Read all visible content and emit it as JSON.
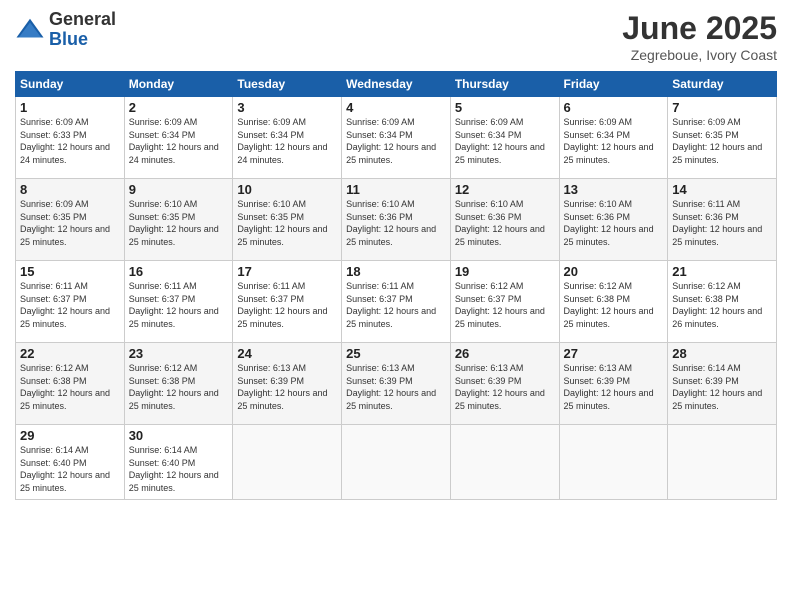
{
  "logo": {
    "general": "General",
    "blue": "Blue"
  },
  "title": "June 2025",
  "subtitle": "Zegreboue, Ivory Coast",
  "weekdays": [
    "Sunday",
    "Monday",
    "Tuesday",
    "Wednesday",
    "Thursday",
    "Friday",
    "Saturday"
  ],
  "weeks": [
    [
      {
        "day": "1",
        "sunrise": "6:09 AM",
        "sunset": "6:33 PM",
        "daylight": "12 hours and 24 minutes."
      },
      {
        "day": "2",
        "sunrise": "6:09 AM",
        "sunset": "6:34 PM",
        "daylight": "12 hours and 24 minutes."
      },
      {
        "day": "3",
        "sunrise": "6:09 AM",
        "sunset": "6:34 PM",
        "daylight": "12 hours and 24 minutes."
      },
      {
        "day": "4",
        "sunrise": "6:09 AM",
        "sunset": "6:34 PM",
        "daylight": "12 hours and 25 minutes."
      },
      {
        "day": "5",
        "sunrise": "6:09 AM",
        "sunset": "6:34 PM",
        "daylight": "12 hours and 25 minutes."
      },
      {
        "day": "6",
        "sunrise": "6:09 AM",
        "sunset": "6:34 PM",
        "daylight": "12 hours and 25 minutes."
      },
      {
        "day": "7",
        "sunrise": "6:09 AM",
        "sunset": "6:35 PM",
        "daylight": "12 hours and 25 minutes."
      }
    ],
    [
      {
        "day": "8",
        "sunrise": "6:09 AM",
        "sunset": "6:35 PM",
        "daylight": "12 hours and 25 minutes."
      },
      {
        "day": "9",
        "sunrise": "6:10 AM",
        "sunset": "6:35 PM",
        "daylight": "12 hours and 25 minutes."
      },
      {
        "day": "10",
        "sunrise": "6:10 AM",
        "sunset": "6:35 PM",
        "daylight": "12 hours and 25 minutes."
      },
      {
        "day": "11",
        "sunrise": "6:10 AM",
        "sunset": "6:36 PM",
        "daylight": "12 hours and 25 minutes."
      },
      {
        "day": "12",
        "sunrise": "6:10 AM",
        "sunset": "6:36 PM",
        "daylight": "12 hours and 25 minutes."
      },
      {
        "day": "13",
        "sunrise": "6:10 AM",
        "sunset": "6:36 PM",
        "daylight": "12 hours and 25 minutes."
      },
      {
        "day": "14",
        "sunrise": "6:11 AM",
        "sunset": "6:36 PM",
        "daylight": "12 hours and 25 minutes."
      }
    ],
    [
      {
        "day": "15",
        "sunrise": "6:11 AM",
        "sunset": "6:37 PM",
        "daylight": "12 hours and 25 minutes."
      },
      {
        "day": "16",
        "sunrise": "6:11 AM",
        "sunset": "6:37 PM",
        "daylight": "12 hours and 25 minutes."
      },
      {
        "day": "17",
        "sunrise": "6:11 AM",
        "sunset": "6:37 PM",
        "daylight": "12 hours and 25 minutes."
      },
      {
        "day": "18",
        "sunrise": "6:11 AM",
        "sunset": "6:37 PM",
        "daylight": "12 hours and 25 minutes."
      },
      {
        "day": "19",
        "sunrise": "6:12 AM",
        "sunset": "6:37 PM",
        "daylight": "12 hours and 25 minutes."
      },
      {
        "day": "20",
        "sunrise": "6:12 AM",
        "sunset": "6:38 PM",
        "daylight": "12 hours and 25 minutes."
      },
      {
        "day": "21",
        "sunrise": "6:12 AM",
        "sunset": "6:38 PM",
        "daylight": "12 hours and 26 minutes."
      }
    ],
    [
      {
        "day": "22",
        "sunrise": "6:12 AM",
        "sunset": "6:38 PM",
        "daylight": "12 hours and 25 minutes."
      },
      {
        "day": "23",
        "sunrise": "6:12 AM",
        "sunset": "6:38 PM",
        "daylight": "12 hours and 25 minutes."
      },
      {
        "day": "24",
        "sunrise": "6:13 AM",
        "sunset": "6:39 PM",
        "daylight": "12 hours and 25 minutes."
      },
      {
        "day": "25",
        "sunrise": "6:13 AM",
        "sunset": "6:39 PM",
        "daylight": "12 hours and 25 minutes."
      },
      {
        "day": "26",
        "sunrise": "6:13 AM",
        "sunset": "6:39 PM",
        "daylight": "12 hours and 25 minutes."
      },
      {
        "day": "27",
        "sunrise": "6:13 AM",
        "sunset": "6:39 PM",
        "daylight": "12 hours and 25 minutes."
      },
      {
        "day": "28",
        "sunrise": "6:14 AM",
        "sunset": "6:39 PM",
        "daylight": "12 hours and 25 minutes."
      }
    ],
    [
      {
        "day": "29",
        "sunrise": "6:14 AM",
        "sunset": "6:40 PM",
        "daylight": "12 hours and 25 minutes."
      },
      {
        "day": "30",
        "sunrise": "6:14 AM",
        "sunset": "6:40 PM",
        "daylight": "12 hours and 25 minutes."
      },
      null,
      null,
      null,
      null,
      null
    ]
  ]
}
